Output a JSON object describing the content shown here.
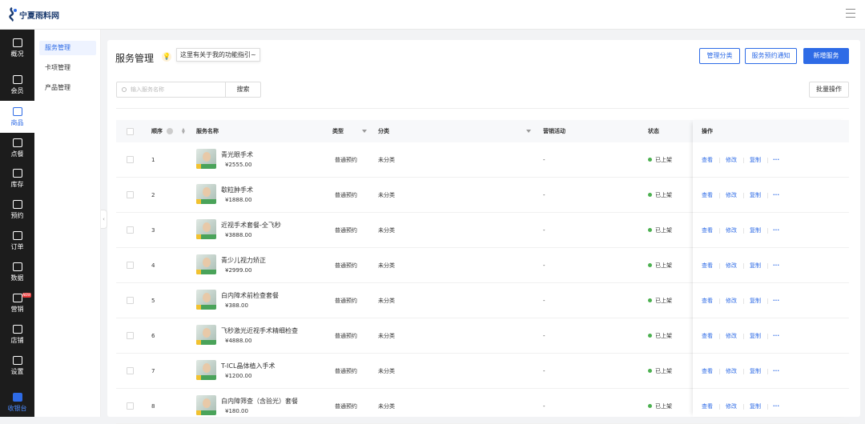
{
  "brand": {
    "name": "宁夏雨料网"
  },
  "left_nav": [
    {
      "label": "概况",
      "icon": "grid-icon"
    },
    {
      "label": "会员",
      "icon": "crown-icon"
    },
    {
      "label": "商品",
      "icon": "shop-icon",
      "active": true
    },
    {
      "label": "点餐",
      "icon": "dish-icon"
    },
    {
      "label": "库存",
      "icon": "warehouse-icon"
    },
    {
      "label": "预约",
      "icon": "calendar-icon"
    },
    {
      "label": "订单",
      "icon": "order-icon"
    },
    {
      "label": "数据",
      "icon": "chart-icon"
    },
    {
      "label": "营销",
      "icon": "gift-icon",
      "badge": "NEW"
    },
    {
      "label": "店铺",
      "icon": "store-icon"
    },
    {
      "label": "设置",
      "icon": "gear-icon"
    }
  ],
  "left_nav_bottom": {
    "label": "收银台",
    "icon": "cashier-icon"
  },
  "sub_nav": [
    "服务管理",
    "卡项管理",
    "产品管理"
  ],
  "header": {
    "title": "服务管理",
    "tip": "这里有关于我的功能指引~",
    "manage_category": "管理分类",
    "booking_notice": "服务预约通知",
    "add_service": "新增服务"
  },
  "search": {
    "placeholder": "输入服务名称",
    "button": "搜索"
  },
  "batch": "批量操作",
  "columns": {
    "order": "顺序",
    "name": "服务名称",
    "type": "类型",
    "category": "分类",
    "marketing": "营销活动",
    "status": "状态",
    "actions": "操作"
  },
  "actions": {
    "view": "查看",
    "edit": "修改",
    "copy": "复制",
    "more": "···"
  },
  "rows": [
    {
      "order": "1",
      "name": "青光眼手术",
      "price": "¥2555.00",
      "type": "普通预约",
      "category": "未分类",
      "marketing": "-",
      "status": "已上架"
    },
    {
      "order": "2",
      "name": "歇粒肿手术",
      "price": "¥1888.00",
      "type": "普通预约",
      "category": "未分类",
      "marketing": "-",
      "status": "已上架"
    },
    {
      "order": "3",
      "name": "近视手术套餐-全飞秒",
      "price": "¥3888.00",
      "type": "普通预约",
      "category": "未分类",
      "marketing": "-",
      "status": "已上架"
    },
    {
      "order": "4",
      "name": "青少儿视力矫正",
      "price": "¥2999.00",
      "type": "普通预约",
      "category": "未分类",
      "marketing": "-",
      "status": "已上架"
    },
    {
      "order": "5",
      "name": "白内障术前检查套餐",
      "price": "¥388.00",
      "type": "普通预约",
      "category": "未分类",
      "marketing": "-",
      "status": "已上架"
    },
    {
      "order": "6",
      "name": "飞秒激光近视手术精细检查",
      "price": "¥4888.00",
      "type": "普通预约",
      "category": "未分类",
      "marketing": "-",
      "status": "已上架"
    },
    {
      "order": "7",
      "name": "T-ICL晶体植入手术",
      "price": "¥1200.00",
      "type": "普通预约",
      "category": "未分类",
      "marketing": "-",
      "status": "已上架"
    },
    {
      "order": "8",
      "name": "白内障筛查（含验光）套餐",
      "price": "¥180.00",
      "type": "普通预约",
      "category": "未分类",
      "marketing": "-",
      "status": "已上架"
    }
  ],
  "colors": {
    "accent": "#2e6be6",
    "status_green": "#4cb050",
    "nav_bg": "#1c1c1c"
  }
}
